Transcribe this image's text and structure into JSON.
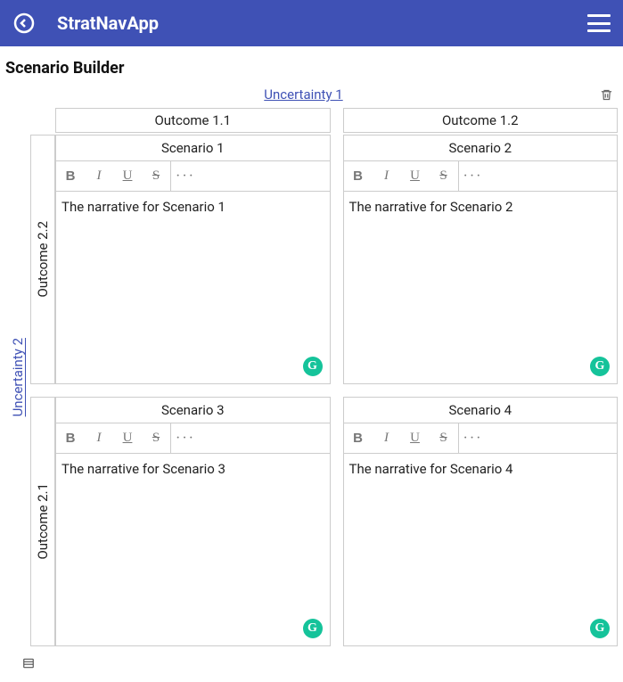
{
  "header": {
    "app_title": "StratNavApp"
  },
  "page": {
    "title": "Scenario Builder"
  },
  "uncertainty_top": {
    "label": "Uncertainty 1"
  },
  "uncertainty_left": {
    "label": "Uncertainty 2"
  },
  "columns": {
    "left": "Outcome 1.1",
    "right": "Outcome 1.2"
  },
  "rows": {
    "top": "Outcome 2.2",
    "bottom": "Outcome 2.1"
  },
  "scenarios": {
    "s1": {
      "title": "Scenario 1",
      "narrative": "The narrative for Scenario 1"
    },
    "s2": {
      "title": "Scenario 2",
      "narrative": "The narrative for Scenario 2"
    },
    "s3": {
      "title": "Scenario 3",
      "narrative": "The narrative for Scenario 3"
    },
    "s4": {
      "title": "Scenario 4",
      "narrative": "The narrative for Scenario 4"
    }
  },
  "toolbar": {
    "bold": "B",
    "italic": "I",
    "underline": "U",
    "strike": "S",
    "more": "···"
  },
  "badges": {
    "grammarly": "G"
  }
}
